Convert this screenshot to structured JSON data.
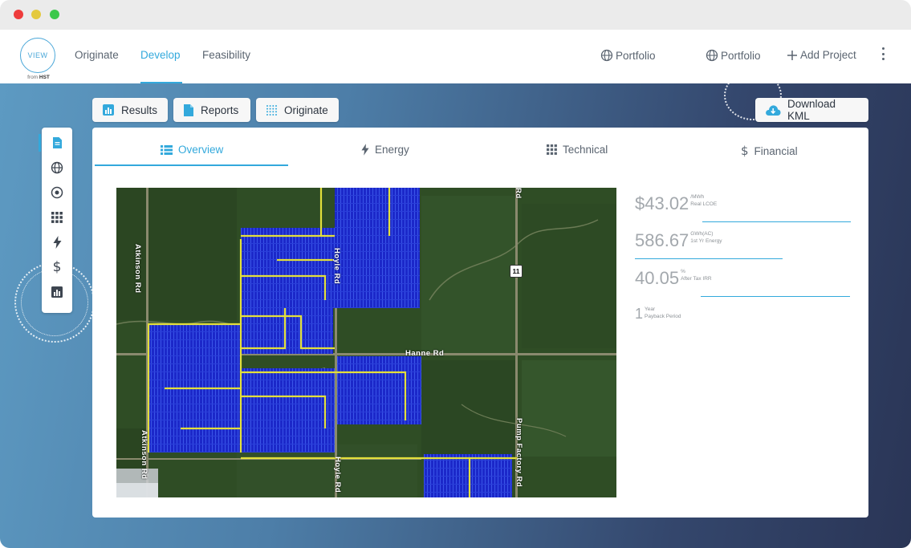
{
  "logo": {
    "mark": "VIEW",
    "from": "from",
    "brand": "HST"
  },
  "nav": {
    "items": [
      {
        "label": "Originate"
      },
      {
        "label": "Develop"
      },
      {
        "label": "Feasibility"
      }
    ],
    "right": {
      "portfolio_1": "Portfolio",
      "portfolio_2": "Portfolio",
      "add_project": "Add Project"
    }
  },
  "actions": {
    "results": "Results",
    "reports": "Reports",
    "originate": "Originate",
    "download_kml": "Download KML"
  },
  "tabs": [
    {
      "label": "Overview"
    },
    {
      "label": "Energy"
    },
    {
      "label": "Technical"
    },
    {
      "label": "Financial"
    }
  ],
  "map": {
    "roads": {
      "atkinson_top": "Atkinson Rd",
      "atkinson_bottom": "Atkinson Rd",
      "hoyle_top": "Hoyle Rd",
      "hoyle_bottom": "Hoyle Rd",
      "hanne": "Hanne Rd",
      "pump_factory": "Pump Factory Rd",
      "top_right_fragment": "Rd",
      "shield": "11"
    }
  },
  "metrics": {
    "lcoe": {
      "value": "$43.02",
      "unit": "/MWh",
      "label": "Real LCOE"
    },
    "energy": {
      "value": "586.67",
      "unit": "GWh(AC)",
      "label": "1st Yr Energy"
    },
    "irr": {
      "value": "40.05",
      "unit": "%",
      "label": "After Tax IRR"
    },
    "payback": {
      "value": "1",
      "unit": "Year",
      "label": "Payback Period"
    }
  },
  "colors": {
    "accent": "#33a9dc",
    "solar_panel": "#1f2fd6",
    "cable": "#e6e03a"
  }
}
